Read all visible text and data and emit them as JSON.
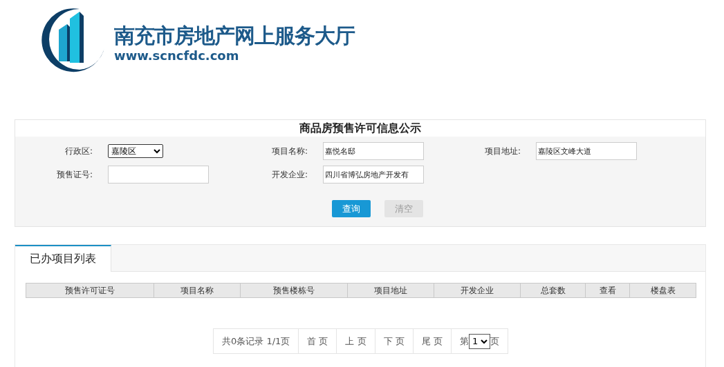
{
  "site": {
    "title": "南充市房地产网上服务大厅",
    "url": "www.scncfdc.com"
  },
  "search_form": {
    "title": "商品房预售许可信息公示",
    "fields": [
      {
        "label": "行政区:",
        "kind": "select",
        "value": "嘉陵区"
      },
      {
        "label": "项目名称:",
        "kind": "input",
        "value": "嘉悦名邸"
      },
      {
        "label": "项目地址:",
        "kind": "input",
        "value": "嘉陵区文峰大道"
      },
      {
        "label": "预售证号:",
        "kind": "input"
      },
      {
        "label": "开发企业:",
        "kind": "input",
        "value": "四川省博弘房地产开发有"
      }
    ],
    "buttons": [
      {
        "label": "查询",
        "kind": "primary"
      },
      {
        "label": "清空",
        "kind": "secondary"
      }
    ]
  },
  "tabs": [
    {
      "label": "已办项目列表",
      "selected": true
    }
  ],
  "table": {
    "columns": [
      "预售许可证号",
      "项目名称",
      "预售楼栋号",
      "项目地址",
      "开发企业",
      "总套数",
      "查看",
      "楼盘表"
    ]
  },
  "pagination": {
    "summary": "共0条记录 1/1页",
    "links": [
      "首 页",
      "上 页",
      "下 页",
      "尾 页"
    ],
    "page_prefix": "第",
    "page_value": "1",
    "page_suffix": "页"
  }
}
